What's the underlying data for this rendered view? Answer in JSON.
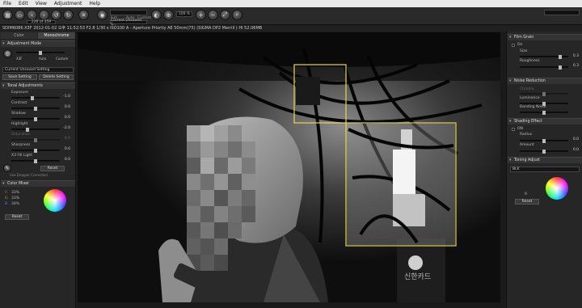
{
  "menu": [
    "File",
    "Edit",
    "View",
    "Adjustment",
    "Help"
  ],
  "toolbar": {
    "counter": "226 of 359",
    "view_labels": [
      "Full",
      "Auto",
      "Custom"
    ],
    "current_setting": "Current Unsaved S...",
    "zoom": "100 %"
  },
  "infobar": "SDIM6086.X3F 2012-01-02 오후 11:52:53 F2.8 1/30 s ISO100 A - Aperture Priority AE 50mm(75) (SIGMA DP2 Merrill ) HI 52.06MB",
  "left": {
    "tabs": [
      "Color",
      "Monochrome"
    ],
    "adjustment_mode": {
      "header": "Adjustment Mode",
      "options": [
        "X3F",
        "Auto",
        "Custom"
      ],
      "setting": "Current Unsaved Setting",
      "save_label": "Save Setting",
      "delete_label": "Delete Setting"
    },
    "tonal": {
      "header": "Tonal Adjustments",
      "sliders": [
        {
          "label": "Exposure",
          "value": "-1.0"
        },
        {
          "label": "Contrast",
          "value": "0.0"
        },
        {
          "label": "Shadow",
          "value": "0.0"
        },
        {
          "label": "Highlight",
          "value": "-2.0"
        },
        {
          "label": "Saturation",
          "value": "0.0"
        },
        {
          "label": "Sharpness",
          "value": "0.0"
        },
        {
          "label": "X3 Fill Light",
          "value": "0.0"
        }
      ],
      "reset_label": "Reset",
      "dropper_label": "Use Dropper Correction"
    },
    "color_mixer": {
      "header": "Color Mixer",
      "channels": [
        {
          "letter": "R",
          "value": "33%",
          "color": "#e04040"
        },
        {
          "letter": "G",
          "value": "33%",
          "color": "#40c040"
        },
        {
          "letter": "B",
          "value": "34%",
          "color": "#4080ff"
        }
      ],
      "reset_label": "Reset"
    }
  },
  "right": {
    "film_grain": {
      "header": "Film Grain",
      "on_label": "On",
      "size_label": "Size",
      "size_value": "0.3",
      "roughness_label": "Roughness",
      "roughness_value": "0.3"
    },
    "noise": {
      "header": "Noise Reduction",
      "labels": [
        "Chroma",
        "Luminance",
        "Banding Noise"
      ]
    },
    "shading": {
      "header": "Shading Effect",
      "on_label": "ON",
      "radius_label": "Radius",
      "radius_value": "0.0",
      "amount_label": "Amount",
      "amount_value": "0.0"
    },
    "toning": {
      "header": "Toning Adjust",
      "select": "BLK",
      "value": "0",
      "reset_label": "Reset"
    }
  },
  "photo": {
    "sign_text": "신한카드"
  }
}
